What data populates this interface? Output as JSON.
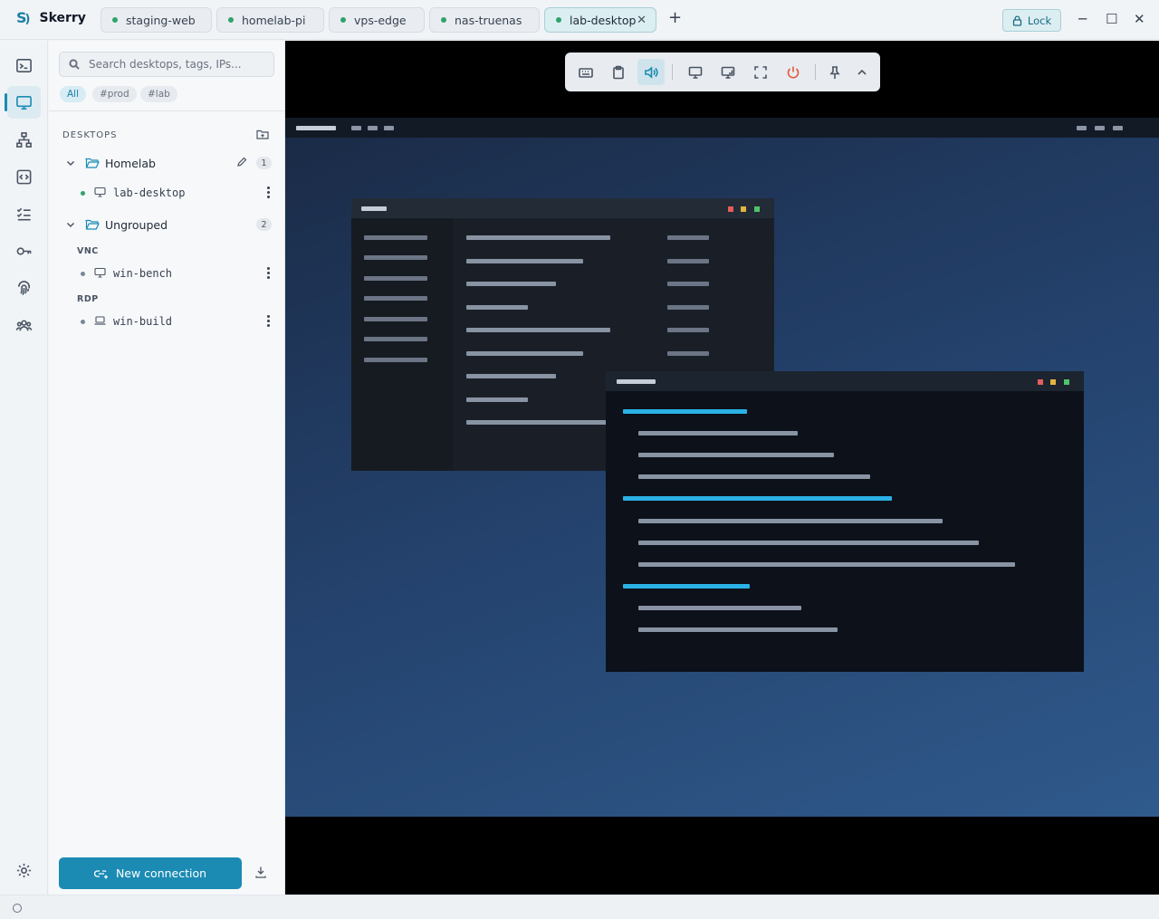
{
  "app": {
    "name": "Skerry",
    "logo_text": "S",
    "logo_mark": ")"
  },
  "tabs": [
    {
      "label": "staging-web",
      "status_color": "#2ea36b"
    },
    {
      "label": "homelab-pi",
      "status_color": "#2ea36b"
    },
    {
      "label": "vps-edge",
      "status_color": "#2ea36b"
    },
    {
      "label": "nas-truenas",
      "status_color": "#2ea36b"
    },
    {
      "label": "lab-desktop",
      "status_color": "#2ea36b",
      "active": true
    }
  ],
  "titlebar": {
    "add_tab_glyph": "+",
    "close_tab_glyph": "✕",
    "lock_label": "Lock",
    "minimize_glyph": "─",
    "maximize_glyph": "☐",
    "close_glyph": "✕"
  },
  "rail": {
    "items": [
      "terminal-icon",
      "desktop-icon",
      "network-icon",
      "code-icon",
      "checklist-icon",
      "key-icon",
      "fingerprint-icon",
      "team-icon"
    ],
    "active": "desktop-icon",
    "bottom": "settings-icon"
  },
  "sidebar": {
    "search": {
      "placeholder": "Search desktops, tags, IPs...",
      "value": ""
    },
    "filters": [
      {
        "label": "All",
        "active": true
      },
      {
        "label": "#prod",
        "active": false
      },
      {
        "label": "#lab",
        "active": false
      }
    ],
    "section_title": "DESKTOPS",
    "groups": [
      {
        "name": "Homelab",
        "count": "1",
        "items": [
          {
            "name": "lab-desktop",
            "status_color": "#2ea36b"
          }
        ]
      },
      {
        "name": "Ungrouped",
        "count": "2",
        "protocols": [
          {
            "label": "VNC",
            "items": [
              {
                "name": "win-bench",
                "status_color": "#7b8794"
              }
            ]
          },
          {
            "label": "RDP",
            "items": [
              {
                "name": "win-build",
                "status_color": "#7b8794"
              }
            ]
          }
        ]
      }
    ],
    "new_connection_label": "New connection"
  },
  "viewer_toolbar": {
    "buttons": [
      "keyboard-icon",
      "clipboard-icon",
      "audio-icon",
      "monitor-icon",
      "scale-icon",
      "fullscreen-icon",
      "disconnect-icon",
      "pin-icon",
      "collapse-icon"
    ],
    "active": "audio-icon",
    "danger_color": "#e05a3a"
  },
  "colors": {
    "accent": "#1b8bb3",
    "online": "#2ea36b",
    "offline": "#7b8794"
  }
}
